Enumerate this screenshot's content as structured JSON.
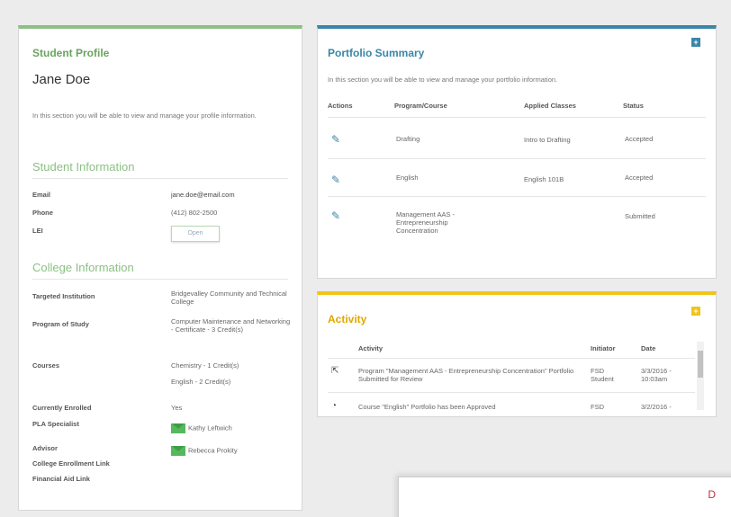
{
  "profile": {
    "title": "Student Profile",
    "name": "Jane Doe",
    "intro": "In this section you will be able to view and manage your profile information.",
    "student_info": {
      "title": "Student Information",
      "email_label": "Email",
      "email_value": "jane.doe@email.com",
      "phone_label": "Phone",
      "phone_value": "(412) 802-2500",
      "lei_label": "LEI",
      "lei_button": "Open"
    },
    "college_info": {
      "title": "College Information",
      "institution_label": "Targeted Institution",
      "institution_value": "Bridgevalley Community and Technical College",
      "program_label": "Program of Study",
      "program_value": "Computer Maintenance and Networking - Certificate - 3 Credit(s)",
      "courses_label": "Courses",
      "course1": "Chemistry - 1 Credit(s)",
      "course2": "English - 2 Credit(s)",
      "enrolled_label": "Currently Enrolled",
      "enrolled_value": "Yes",
      "pla_label": "PLA Specialist",
      "pla_value": "Kathy Leftwich",
      "advisor_label": "Advisor",
      "advisor_value": "Rebecca Prokity",
      "enroll_link_label": "College Enrollment Link",
      "aid_link_label": "Financial Aid Link"
    }
  },
  "portfolio": {
    "title": "Portfolio Summary",
    "intro": "In this section you will be able to view and manage your portfolio information.",
    "headers": [
      "Actions",
      "Program/Course",
      "Applied Classes",
      "Status"
    ],
    "rows": [
      {
        "program": "Drafting",
        "classes": "Intro to Drafting",
        "status": "Accepted"
      },
      {
        "program": "English",
        "classes": "English 101B",
        "status": "Accepted"
      },
      {
        "program": "Management AAS - Entrepreneurship Concentration",
        "classes": "",
        "status": "Submitted"
      }
    ]
  },
  "activity": {
    "title": "Activity",
    "headers": [
      "Activity",
      "Initiator",
      "Date"
    ],
    "rows": [
      {
        "icon": "export-icon",
        "text": "Program \"Management AAS - Entrepreneurship Concentration\" Portfolio Submitted for Review",
        "initiator": "FSD Student",
        "date": "3/3/2016 - 10:03am"
      },
      {
        "icon": "gauge-icon",
        "text": "Course \"English\" Portfolio has been Approved",
        "initiator": "FSD",
        "date": "3/2/2016 -"
      }
    ]
  },
  "bottom_panel": {
    "mark": "D"
  },
  "colors": {
    "profile_accent": "#8cc084",
    "portfolio_accent": "#3a86a8",
    "activity_accent": "#f0c419"
  }
}
